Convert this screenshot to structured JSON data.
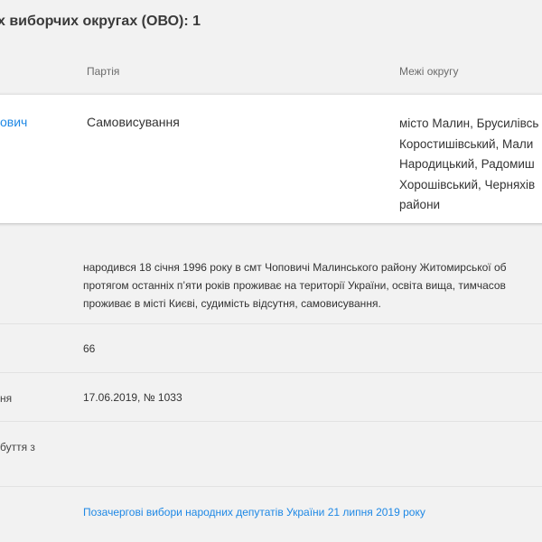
{
  "heading": "х виборчих округах (ОВО): 1",
  "table": {
    "col_party": "Партія",
    "col_bounds": "Межі округу",
    "row": {
      "name": "ович",
      "party": "Самовисування",
      "bounds_lines": [
        "місто Малин, Брусилівсь",
        "Коростишівський, Мали",
        "Народицький, Радомиш",
        "Хорошівський, Черняхів",
        "райони"
      ]
    }
  },
  "info": {
    "bio_lines": [
      "народився 18 січня 1996 року в смт Чоповичі Малинського району Житомирської об",
      "протягом останніх п’яти років проживає на території України, освіта вища, тимчасов",
      "проживає в місті Києві, судимість відсутня, самовисування."
    ],
    "number_value": "66",
    "registration_label": "ня",
    "registration_value": "17.06.2019, № 1033",
    "dropout_label_line1": "буття з",
    "election_link": "Позачергові вибори народних депутатів України 21 липня 2019 року"
  }
}
